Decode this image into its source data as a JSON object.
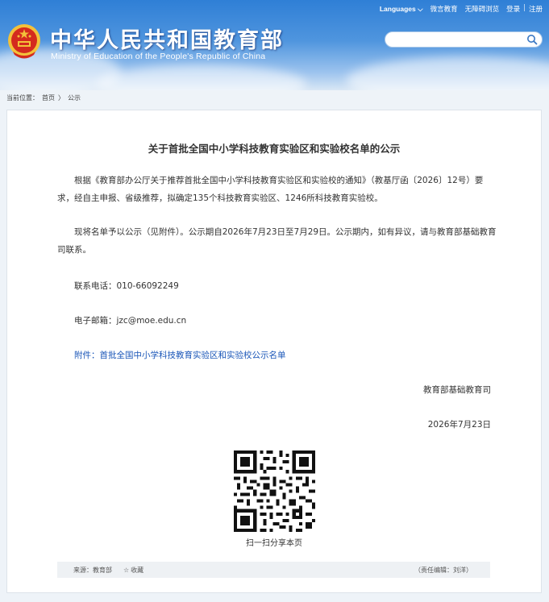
{
  "header": {
    "logo_cn": "中华人民共和国教育部",
    "logo_en": "Ministry of Education of the People's Republic of China",
    "links": {
      "languages": "Languages",
      "weibo": "微言教育",
      "accessibility": "无障碍浏览",
      "login": "登录",
      "separator": "|",
      "register": "注册"
    },
    "search": {
      "placeholder": ""
    }
  },
  "breadcrumb": {
    "prefix": "当前位置：",
    "home": "首页",
    "arrow": "〉",
    "current": "公示"
  },
  "article": {
    "title": "关于首批全国中小学科技教育实验区和实验校名单的公示",
    "para1": "根据《教育部办公厅关于推荐首批全国中小学科技教育实验区和实验校的通知》（教基厅函〔2026〕12号）要求，经自主申报、省级推荐，拟确定135个科技教育实验区、1246所科技教育实验校。",
    "para2": "现将名单予以公示（见附件）。公示期自2026年7月23日至7月29日。公示期内，如有异议，请与教育部基础教育司联系。",
    "phone_label": "联系电话：",
    "phone": "010-66092249",
    "email_label": "电子邮箱：",
    "email": "jzc@moe.edu.cn",
    "attachment_label": "附件：",
    "attachment_link": "首批全国中小学科技教育实验区和实验校公示名单",
    "signature": "教育部基础教育司",
    "date": "2026年7月23日",
    "qr_caption": "扫一扫分享本页"
  },
  "footer": {
    "source": "来源：教育部",
    "favorite": "收藏",
    "editor": "（责任编辑：刘洋）"
  },
  "colors": {
    "link": "#1a56b8",
    "header_top": "#2f7fd6",
    "emblem_red": "#d42a1e",
    "emblem_gold": "#f3c13a"
  }
}
